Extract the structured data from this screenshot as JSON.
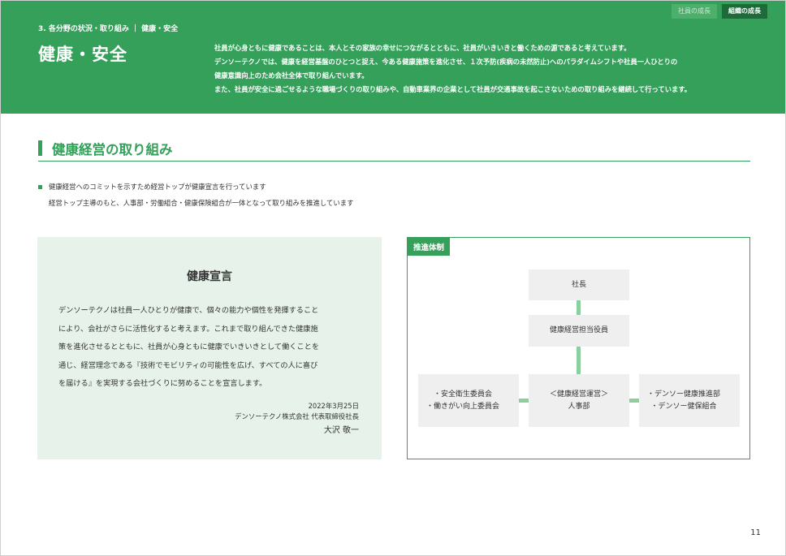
{
  "header": {
    "tabs": [
      {
        "label": "社員の成長",
        "active": false
      },
      {
        "label": "組織の成長",
        "active": true
      }
    ],
    "breadcrumb": "3. 各分野の状況・取り組み ｜ 健康・安全",
    "title": "健康・安全",
    "intro": [
      "社員が心身ともに健康であることは、本人とその家族の幸せにつながるとともに、社員がいきいきと働くための源であると考えています。",
      "デンソーテクノでは、健康を経営基盤のひとつと捉え、今ある健康施策を進化させ、１次予防(疾病の未然防止)へのパラダイムシフトや社員一人ひとりの",
      "健康意識向上のため会社全体で取り組んでいます。",
      "また、社員が安全に過ごせるような職場づくりの取り組みや、自動車業界の企業として社員が交通事故を起こさないための取り組みを継続して行っています。"
    ]
  },
  "section": {
    "title": "健康経営の取り組み",
    "bullet_1": "健康経営へのコミットを示すため経営トップが健康宣言を行っています",
    "bullet_2": "経営トップ主導のもと、人事部・労働組合・健康保険組合が一体となって取り組みを推進しています"
  },
  "declaration": {
    "title": "健康宣言",
    "body": [
      "デンソーテクノは社員一人ひとりが健康で、個々の能力や個性を発揮すること",
      "により、会社がさらに活性化すると考えます。これまで取り組んできた健康施",
      "策を進化させるとともに、社員が心身ともに健康でいきいきとして働くことを",
      "通じ、経営理念である『技術でモビリティの可能性を広げ、すべての人に喜び",
      "を届ける』を実現する会社づくりに努めることを宣言します。"
    ],
    "date": "2022年3月25日",
    "company": "デンソーテクノ株式会社 代表取締役社長",
    "name": "大沢 敬一"
  },
  "org_chart": {
    "label": "推進体制",
    "president": "社長",
    "officer": "健康経営担当役員",
    "center_line1": "＜健康経営運営＞",
    "center_line2": "人事部",
    "left_items": [
      "・安全衛生委員会",
      "・働きがい向上委員会"
    ],
    "right_items": [
      "・デンソー健康推進部",
      "・デンソー健保組合"
    ]
  },
  "page_number": "11",
  "colors": {
    "brand_green": "#34a05a",
    "dark_green": "#1e6b3a",
    "light_green_bg": "#e7f3ea",
    "connector": "#8ccf9f",
    "node_bg": "#efefef"
  }
}
